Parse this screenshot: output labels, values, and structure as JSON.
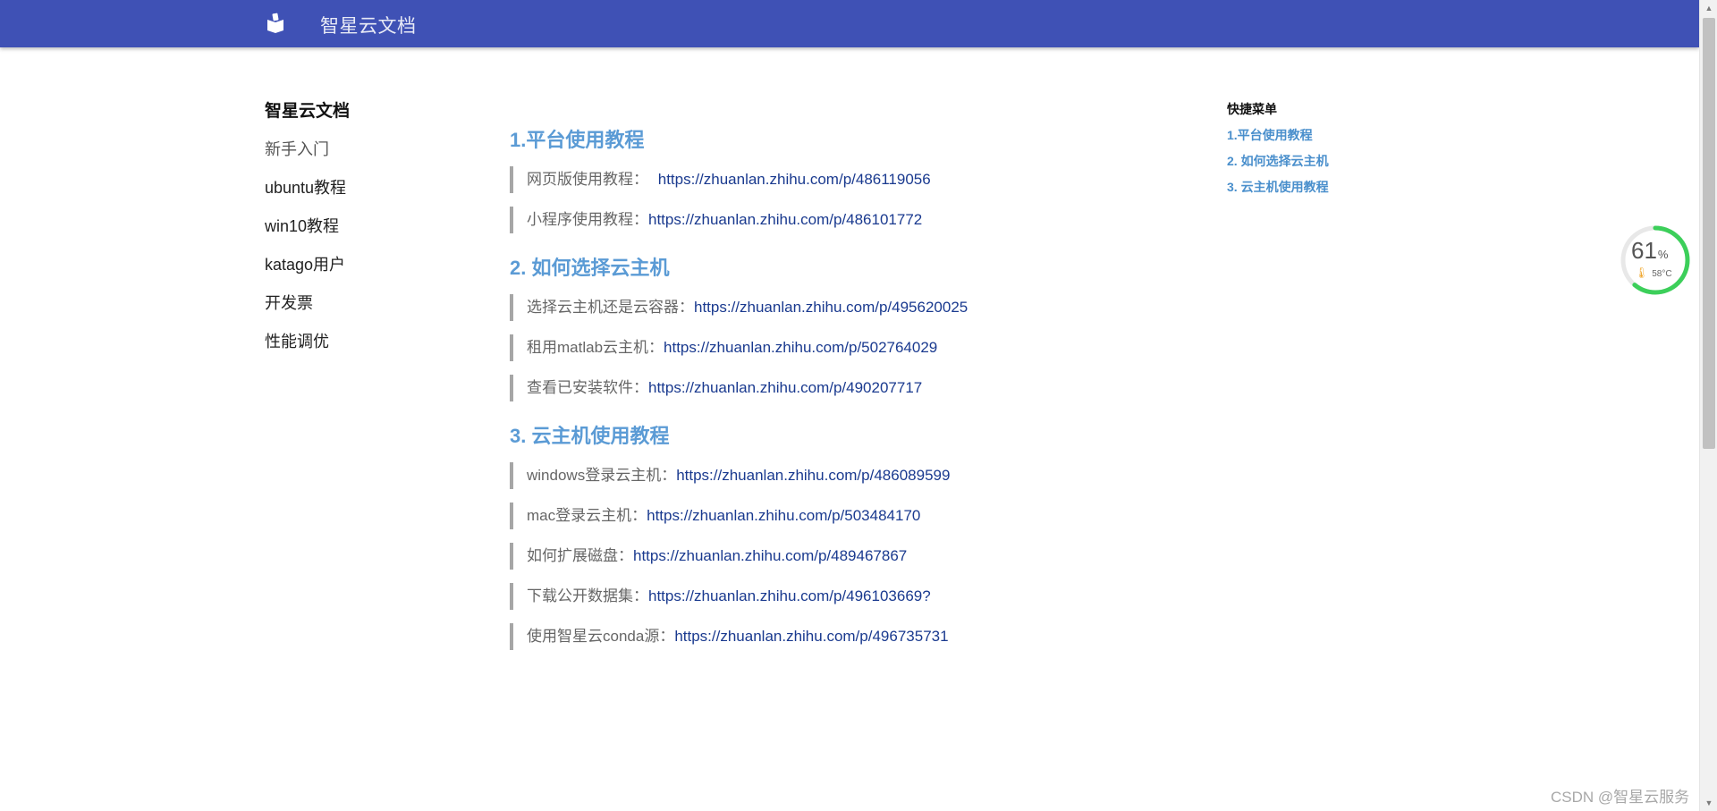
{
  "header": {
    "title": "智星云文档",
    "icon": "book-icon",
    "background": "#3f51b5"
  },
  "sidebar": {
    "title": "智星云文档",
    "items": [
      {
        "label": "新手入门",
        "active": true
      },
      {
        "label": "ubuntu教程"
      },
      {
        "label": "win10教程"
      },
      {
        "label": "katago用户"
      },
      {
        "label": "开发票"
      },
      {
        "label": "性能调优"
      }
    ]
  },
  "main": {
    "sections": [
      {
        "title": "1.平台使用教程",
        "entries": [
          {
            "label": "网页版使用教程：",
            "link": "https://zhuanlan.zhihu.com/p/486119056",
            "gap": true
          },
          {
            "label": "小程序使用教程：",
            "link": "https://zhuanlan.zhihu.com/p/486101772"
          }
        ]
      },
      {
        "title": "2. 如何选择云主机",
        "entries": [
          {
            "label": "选择云主机还是云容器：",
            "link": "https://zhuanlan.zhihu.com/p/495620025"
          },
          {
            "label": "租用matlab云主机：",
            "link": "https://zhuanlan.zhihu.com/p/502764029"
          },
          {
            "label": "查看已安装软件：",
            "link": "https://zhuanlan.zhihu.com/p/490207717"
          }
        ]
      },
      {
        "title": "3. 云主机使用教程",
        "entries": [
          {
            "label": "windows登录云主机：",
            "link": "https://zhuanlan.zhihu.com/p/486089599"
          },
          {
            "label": "mac登录云主机：",
            "link": "https://zhuanlan.zhihu.com/p/503484170"
          },
          {
            "label": "如何扩展磁盘：",
            "link": "https://zhuanlan.zhihu.com/p/489467867"
          },
          {
            "label": "下载公开数据集：",
            "link": "https://zhuanlan.zhihu.com/p/496103669?"
          },
          {
            "label": "使用智星云conda源：",
            "link": "https://zhuanlan.zhihu.com/p/496735731"
          }
        ]
      }
    ]
  },
  "quick_menu": {
    "title": "快捷菜单",
    "items": [
      {
        "label": "1.平台使用教程"
      },
      {
        "label": "2. 如何选择云主机"
      },
      {
        "label": "3. 云主机使用教程"
      }
    ]
  },
  "perf_widget": {
    "value": "61",
    "unit": "%",
    "level": 0.61,
    "temp": "58°C",
    "ring_color": "#3ccf5a",
    "track_color": "#e8e8e8"
  },
  "watermark": {
    "text": "CSDN @智星云服务"
  },
  "colors": {
    "section_title": "#5b9bd5",
    "link": "#1a3a8f",
    "quick_item": "#4a8fcc",
    "entry_bar": "#a6a6a6"
  }
}
